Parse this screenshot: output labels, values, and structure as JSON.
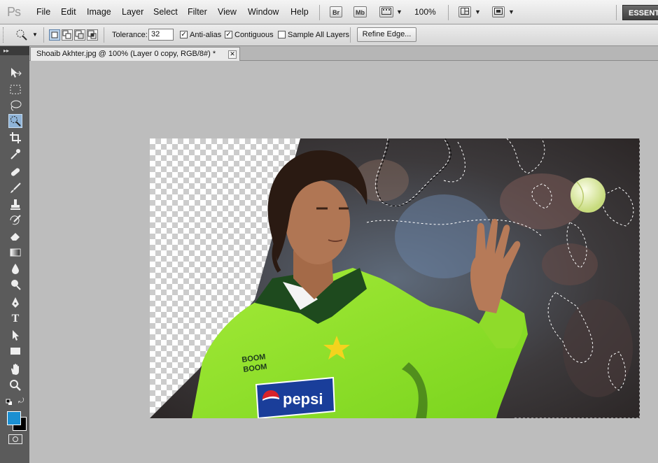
{
  "app": {
    "logo": "Ps"
  },
  "menu": [
    "File",
    "Edit",
    "Image",
    "Layer",
    "Select",
    "Filter",
    "View",
    "Window",
    "Help"
  ],
  "menubar_buttons": {
    "bridge": "Br",
    "mini_bridge": "Mb",
    "zoom": "100%",
    "workspace": "ESSENT"
  },
  "options": {
    "tolerance_label": "Tolerance:",
    "tolerance_value": "32",
    "anti_alias_label": "Anti-alias",
    "anti_alias_checked": true,
    "contiguous_label": "Contiguous",
    "contiguous_checked": true,
    "sample_all_label": "Sample All Layers",
    "sample_all_checked": false,
    "refine_edge_label": "Refine Edge..."
  },
  "document": {
    "tab_title": "Shoaib Akhter.jpg @ 100% (Layer 0 copy, RGB/8#) *",
    "close_glyph": "✕"
  },
  "jersey": {
    "sponsor_line1": "BOOM",
    "sponsor_line2": "BOOM",
    "logo_text": "pepsi"
  },
  "colors": {
    "foreground": "#1b8fd1",
    "background": "#000000",
    "jersey": "#8ee22a"
  },
  "tools": [
    "move",
    "marquee",
    "lasso",
    "quick-selection",
    "crop",
    "eyedropper",
    "healing-brush",
    "brush",
    "clone-stamp",
    "history-brush",
    "eraser",
    "gradient",
    "blur",
    "dodge",
    "pen",
    "type",
    "path-selection",
    "shape",
    "hand",
    "zoom"
  ]
}
